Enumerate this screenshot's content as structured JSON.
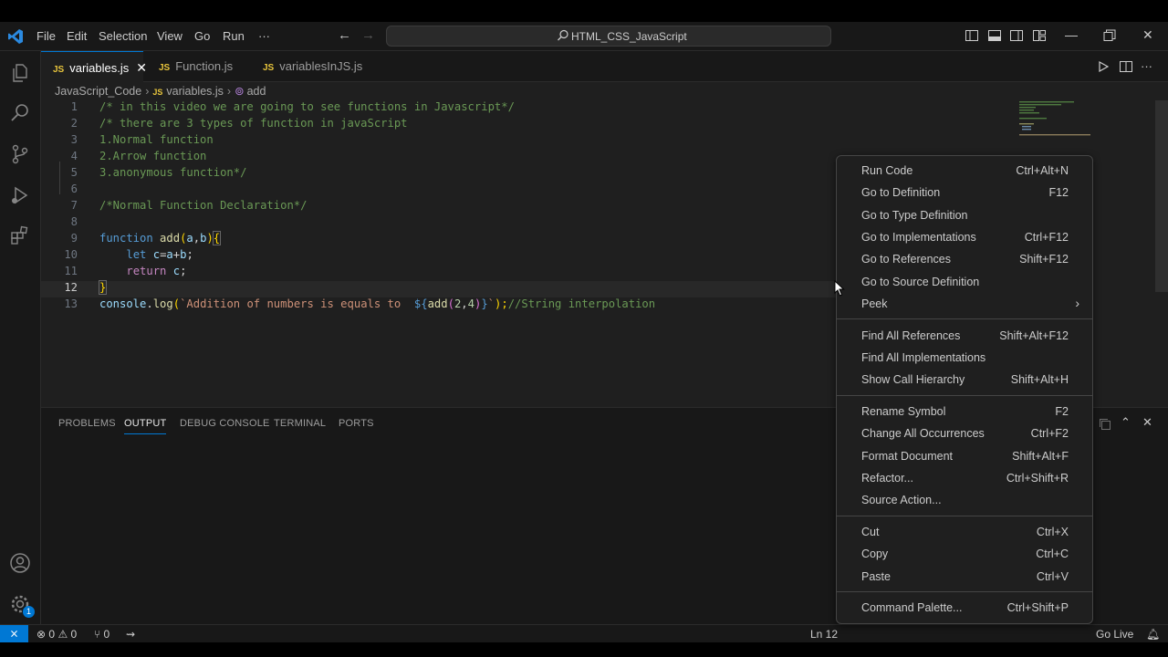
{
  "titlebar": {
    "menu": [
      "File",
      "Edit",
      "Selection",
      "View",
      "Go",
      "Run",
      "···"
    ],
    "search_text": "HTML_CSS_JavaScript",
    "accent": "#0078d4"
  },
  "tabs": [
    {
      "icon": "JS",
      "label": "variables.js",
      "close": "✕"
    },
    {
      "icon": "JS",
      "label": "Function.js"
    },
    {
      "icon": "JS",
      "label": "variablesInJS.js"
    }
  ],
  "breadcrumb": {
    "folder": "JavaScript_Code",
    "file_icon": "JS",
    "file": "variables.js",
    "symbol": "add"
  },
  "editor": {
    "current_line": 12,
    "lines": [
      {
        "n": "1",
        "comment": "/* in this video we are going to see functions in Javascript*/"
      },
      {
        "n": "2",
        "comment": "/* there are 3 types of function in javaScript"
      },
      {
        "n": "3",
        "comment": "1.Normal function"
      },
      {
        "n": "4",
        "comment": "2.Arrow function"
      },
      {
        "n": "5",
        "comment": "3.anonymous function*/"
      },
      {
        "n": "6"
      },
      {
        "n": "7",
        "comment": "/*Normal Function Declaration*/"
      },
      {
        "n": "8"
      },
      {
        "n": "9",
        "kw": "function",
        "name": "add",
        "params_open": "(",
        "p1": "a",
        "comma": ",",
        "p2": "b",
        "params_close": ")",
        "brace": "{"
      },
      {
        "n": "10",
        "kw": "let",
        "v1": "c",
        "eq": "=",
        "v2": "a",
        "plus": "+",
        "v3": "b",
        "semi": ";"
      },
      {
        "n": "11",
        "kw": "return",
        "v1": "c",
        "semi": ";"
      },
      {
        "n": "12",
        "brace": "}"
      },
      {
        "n": "13",
        "obj": "console",
        "dot": ".",
        "method": "log",
        "open": "(",
        "str1": "`Addition of numbers is equals to  ",
        "tmpl_open": "${",
        "call": "add",
        "call_open": "(",
        "arg1": "2",
        "comma": ",",
        "arg2": "4",
        "call_close": ")",
        "tmpl_close": "}",
        "str2": "`",
        "close": ");",
        "comment": "//String interpolation"
      }
    ]
  },
  "panel": {
    "tabs": [
      "PROBLEMS",
      "OUTPUT",
      "DEBUG CONSOLE",
      "TERMINAL",
      "PORTS"
    ],
    "active": "OUTPUT"
  },
  "context_menu": {
    "groups": [
      [
        {
          "label": "Run Code",
          "key": "Ctrl+Alt+N"
        },
        {
          "label": "Go to Definition",
          "key": "F12"
        },
        {
          "label": "Go to Type Definition",
          "key": ""
        },
        {
          "label": "Go to Implementations",
          "key": "Ctrl+F12"
        },
        {
          "label": "Go to References",
          "key": "Shift+F12"
        },
        {
          "label": "Go to Source Definition",
          "key": ""
        },
        {
          "label": "Peek",
          "key": "",
          "submenu": true
        }
      ],
      [
        {
          "label": "Find All References",
          "key": "Shift+Alt+F12"
        },
        {
          "label": "Find All Implementations",
          "key": ""
        },
        {
          "label": "Show Call Hierarchy",
          "key": "Shift+Alt+H"
        }
      ],
      [
        {
          "label": "Rename Symbol",
          "key": "F2"
        },
        {
          "label": "Change All Occurrences",
          "key": "Ctrl+F2"
        },
        {
          "label": "Format Document",
          "key": "Shift+Alt+F"
        },
        {
          "label": "Refactor...",
          "key": "Ctrl+Shift+R"
        },
        {
          "label": "Source Action...",
          "key": ""
        }
      ],
      [
        {
          "label": "Cut",
          "key": "Ctrl+X"
        },
        {
          "label": "Copy",
          "key": "Ctrl+C"
        },
        {
          "label": "Paste",
          "key": "Ctrl+V"
        }
      ],
      [
        {
          "label": "Command Palette...",
          "key": "Ctrl+Shift+P"
        }
      ]
    ]
  },
  "statusbar": {
    "errors": "0",
    "warnings": "0",
    "ports": "0",
    "position": "Ln 12",
    "go_live": "Go Live",
    "settings_badge": "1"
  },
  "icons": {
    "remote": "remote-icon",
    "explorer": "files-icon",
    "search": "search-icon",
    "source_control": "source-control-icon",
    "run_debug": "run-debug-icon",
    "extensions": "extensions-icon",
    "account": "account-icon",
    "manage": "gear-icon"
  }
}
